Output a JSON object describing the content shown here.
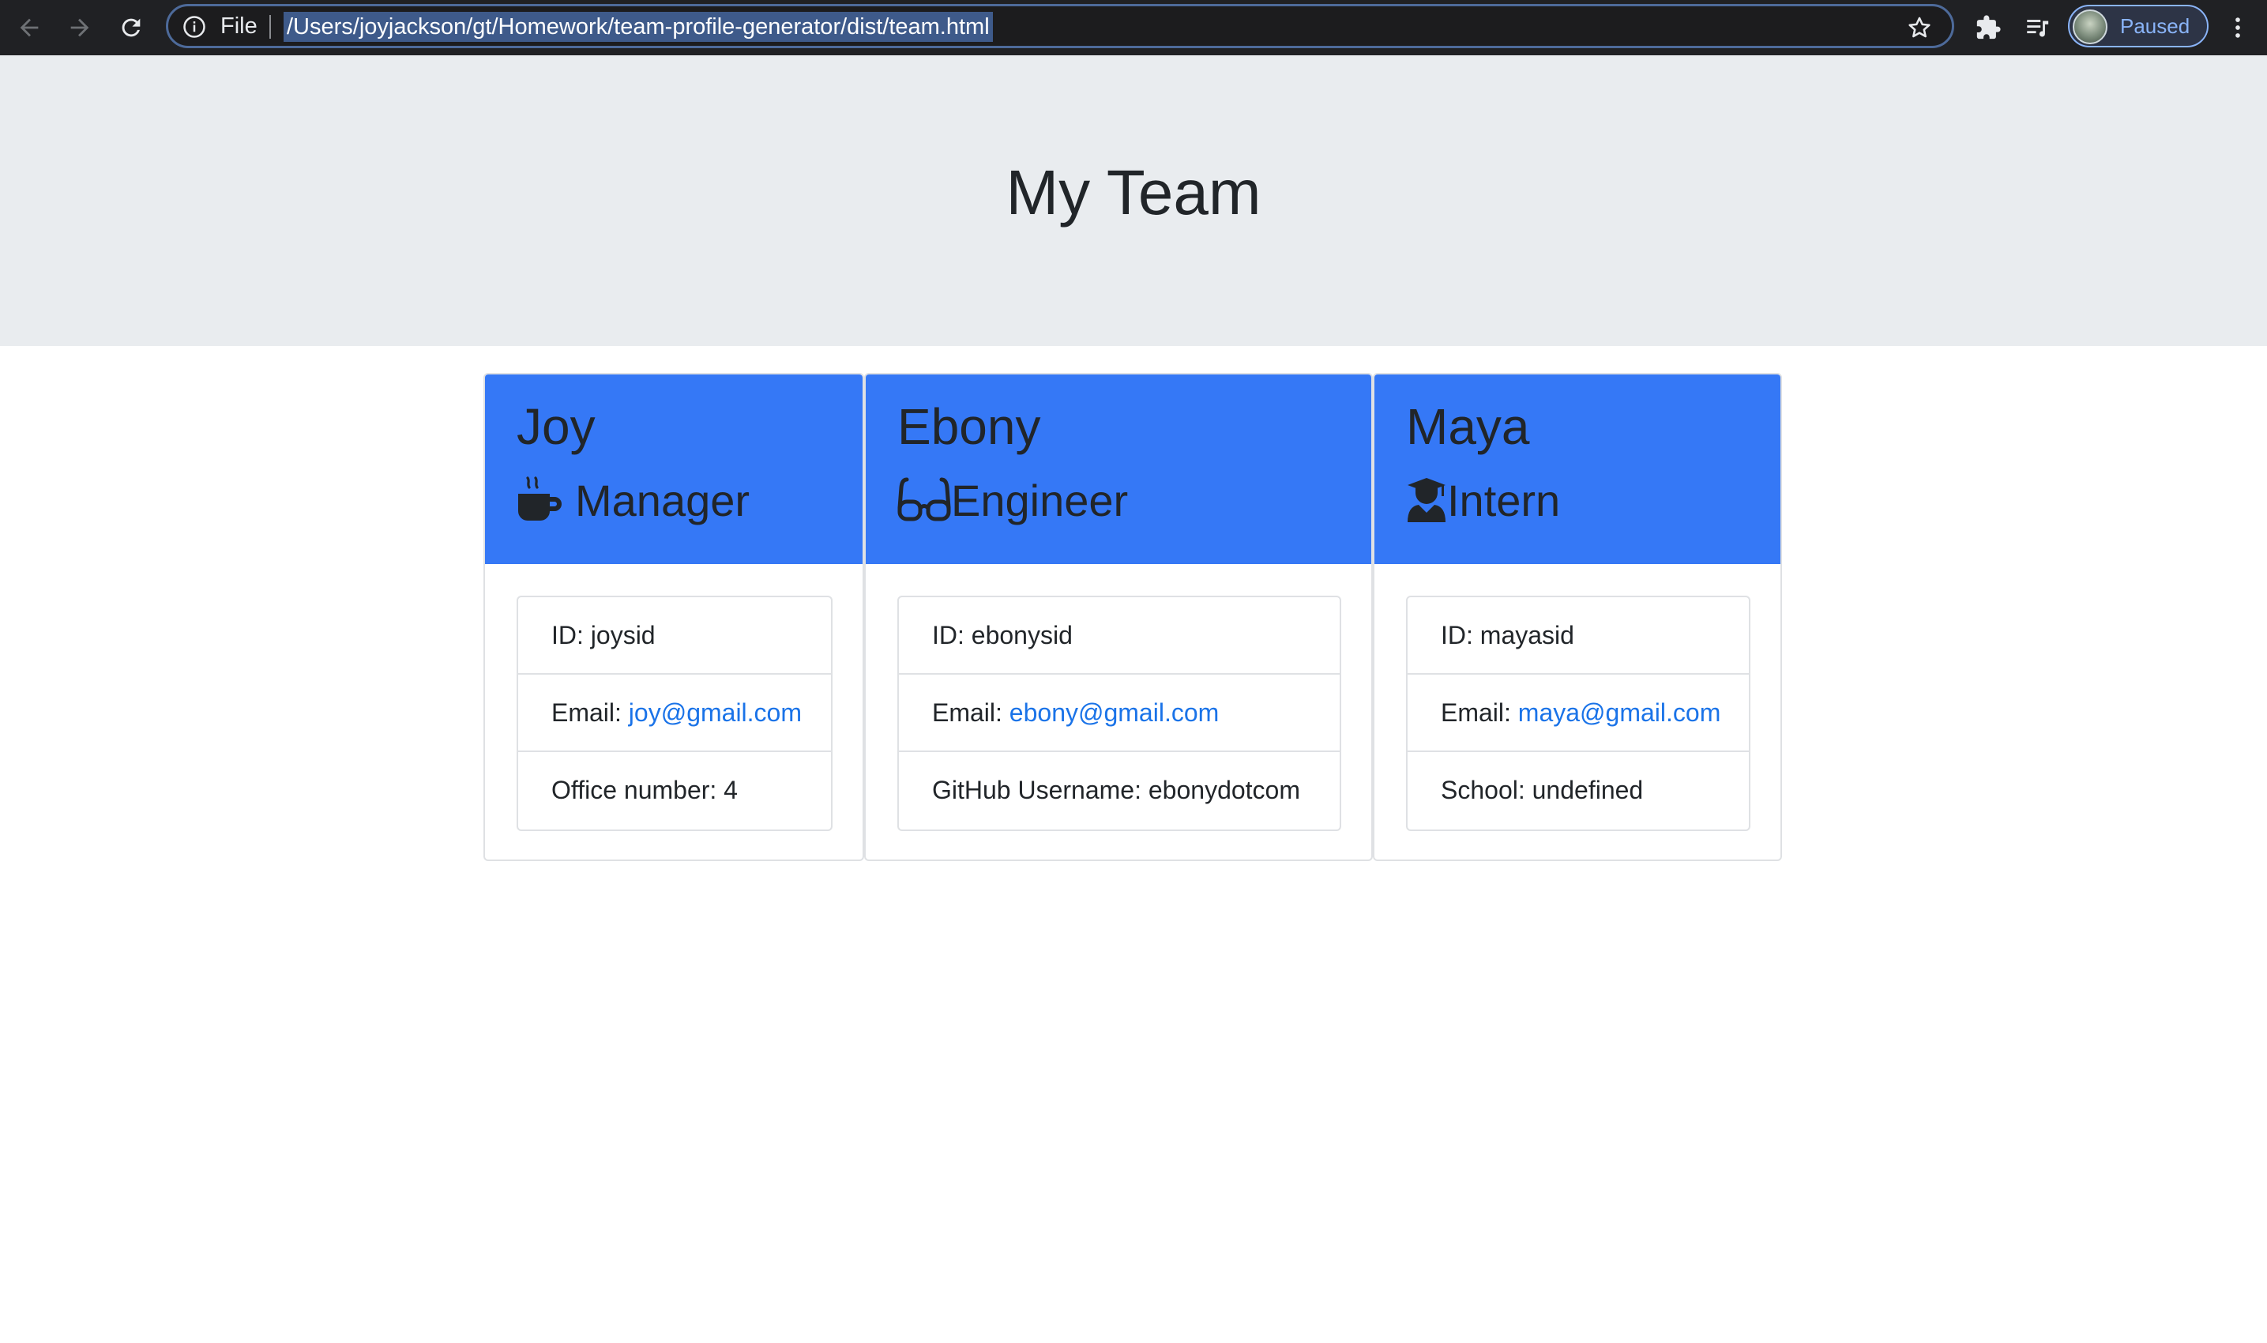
{
  "browser": {
    "scheme_label": "File",
    "url": "/Users/joyjackson/gt/Homework/team-profile-generator/dist/team.html",
    "profile_status": "Paused",
    "icons": [
      "back-arrow-icon",
      "forward-arrow-icon",
      "reload-icon",
      "info-icon",
      "star-icon",
      "extensions-puzzle-icon",
      "reading-list-icon",
      "kebab-menu-icon"
    ]
  },
  "page": {
    "title": "My Team",
    "header_color": "#3578f6",
    "link_color": "#1a73e8"
  },
  "cards": [
    {
      "name": "Joy",
      "role": "Manager",
      "role_icon": "mug-hot-icon",
      "id_label": "ID: ",
      "id_value": "joysid",
      "email_label": "Email: ",
      "email": "joy@gmail.com",
      "extra_label": "Office number: ",
      "extra_value": "4"
    },
    {
      "name": "Ebony",
      "role": "Engineer",
      "role_icon": "glasses-icon",
      "id_label": "ID: ",
      "id_value": "ebonysid",
      "email_label": "Email: ",
      "email": "ebony@gmail.com",
      "extra_label": "GitHub Username: ",
      "extra_value": "ebonydotcom"
    },
    {
      "name": "Maya",
      "role": "Intern",
      "role_icon": "user-graduate-icon",
      "id_label": "ID: ",
      "id_value": "mayasid",
      "email_label": "Email: ",
      "email": "maya@gmail.com",
      "extra_label": "School: ",
      "extra_value": "undefined"
    }
  ]
}
